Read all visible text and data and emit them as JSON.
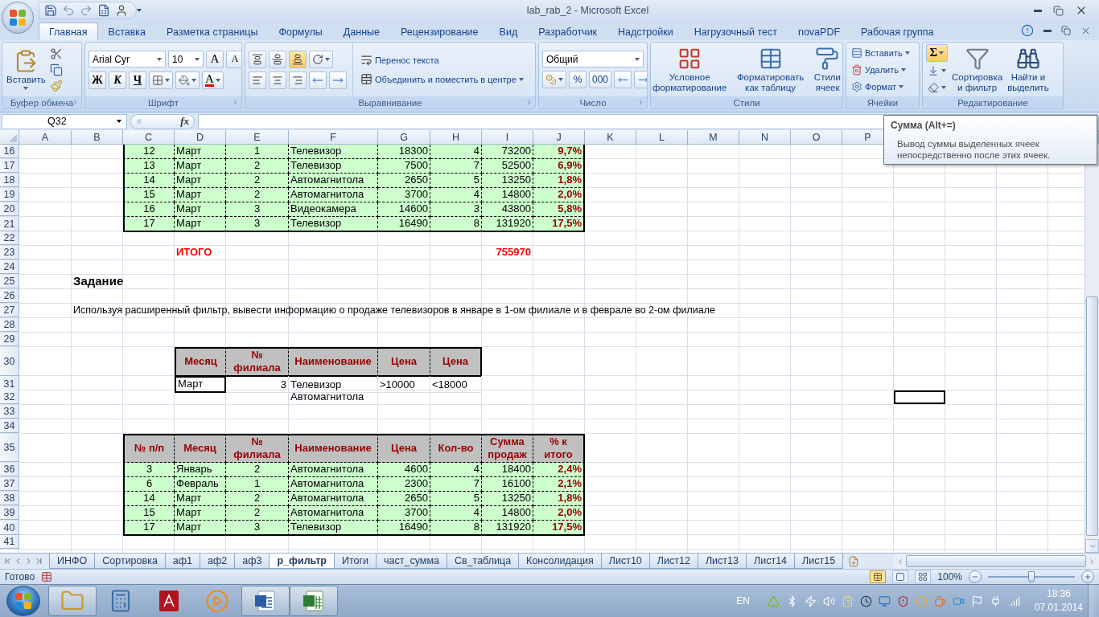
{
  "title_bar": {
    "title": "lab_rab_2 - Microsoft Excel"
  },
  "ribbon_tabs": [
    {
      "label": "Главная",
      "selected": true
    },
    {
      "label": "Вставка",
      "selected": false
    },
    {
      "label": "Разметка страницы",
      "selected": false
    },
    {
      "label": "Формулы",
      "selected": false
    },
    {
      "label": "Данные",
      "selected": false
    },
    {
      "label": "Рецензирование",
      "selected": false
    },
    {
      "label": "Вид",
      "selected": false
    },
    {
      "label": "Разработчик",
      "selected": false
    },
    {
      "label": "Надстройки",
      "selected": false
    },
    {
      "label": "Нагрузочный тест",
      "selected": false
    },
    {
      "label": "novaPDF",
      "selected": false
    },
    {
      "label": "Рабочая группа",
      "selected": false
    }
  ],
  "ribbon": {
    "clipboard": {
      "paste": "Вставить",
      "label": "Буфер обмена"
    },
    "font": {
      "name": "Arial Cyr",
      "size": "10",
      "grow": "A",
      "shrink": "A",
      "bold": "Ж",
      "italic": "К",
      "underline": "Ч",
      "color_letter": "A",
      "label": "Шрифт"
    },
    "alignment": {
      "vertical": [
        {
          "selected": false
        },
        {
          "selected": false
        },
        {
          "selected": true
        }
      ],
      "wrap": "Перенос текста",
      "merge": "Объединить и поместить в центре",
      "label": "Выравнивание"
    },
    "number": {
      "format": "Общий",
      "percent": "%",
      "thousands": "000",
      "label": "Число"
    },
    "styles": {
      "buttons": [
        "Условное\nформатирование",
        "Форматировать\nкак таблицу",
        "Стили\nячеек"
      ],
      "label": "Стили"
    },
    "cells": {
      "buttons": [
        "Вставить",
        "Удалить",
        "Формат"
      ],
      "label": "Ячейки"
    },
    "editing": {
      "sum": "Σ",
      "sum_hovered": true,
      "buttons": [
        "Сортировка\nи фильтр",
        "Найти и\nвыделить"
      ],
      "label": "Редактирование"
    }
  },
  "formula_bar": {
    "name_box": "Q32",
    "fx": "fx"
  },
  "sheet": {
    "columns": [
      "A",
      "B",
      "C",
      "D",
      "E",
      "F",
      "G",
      "H",
      "I",
      "J",
      "K",
      "L",
      "M",
      "N",
      "O",
      "P"
    ],
    "row_numbers": [
      "16",
      "17",
      "18",
      "19",
      "20",
      "21",
      "22",
      "23",
      "24",
      "25",
      "26",
      "27",
      "28",
      "29",
      "30",
      "31",
      "32",
      "33",
      "34",
      "35",
      "36",
      "37",
      "38",
      "39",
      "40",
      "41"
    ],
    "sales_rows": [
      [
        "12",
        "Март",
        "1",
        "Телевизор",
        "18300",
        "4",
        "73200",
        "9,7%"
      ],
      [
        "13",
        "Март",
        "2",
        "Телевизор",
        "7500",
        "7",
        "52500",
        "6,9%"
      ],
      [
        "14",
        "Март",
        "2",
        "Автомагнитола",
        "2650",
        "5",
        "13250",
        "1,8%"
      ],
      [
        "15",
        "Март",
        "2",
        "Автомагнитола",
        "3700",
        "4",
        "14800",
        "2,0%"
      ],
      [
        "16",
        "Март",
        "3",
        "Видеокамера",
        "14600",
        "3",
        "43800",
        "5,8%"
      ],
      [
        "17",
        "Март",
        "3",
        "Телевизор",
        "16490",
        "8",
        "131920",
        "17,5%"
      ]
    ],
    "total": {
      "label": "ИТОГО",
      "value": "755970"
    },
    "task_heading": "Задание",
    "task_text": "Используя расширенный фильтр, вывести информацию о продаже телевизоров в январе в 1-ом филиале и в феврале во 2-ом филиале",
    "criteria": {
      "headers": [
        "Месяц",
        "№\nфилиала",
        "Наименование",
        "Цена",
        "Цена"
      ],
      "rows": [
        {
          "month": "Март",
          "branch": "3",
          "name": "Телевизор",
          "price_min": ">10000",
          "price_max": "<18000"
        },
        {
          "name": "Автомагнитола"
        }
      ]
    },
    "result": {
      "headers": [
        "№ п/п",
        "Месяц",
        "№\nфилиала",
        "Наименование",
        "Цена",
        "Кол-во",
        "Сумма\nпродаж",
        "% к\nитого"
      ],
      "rows": [
        [
          "3",
          "Январь",
          "2",
          "Автомагнитола",
          "4600",
          "4",
          "18400",
          "2,4%"
        ],
        [
          "6",
          "Февраль",
          "1",
          "Автомагнитола",
          "2300",
          "7",
          "16100",
          "2,1%"
        ],
        [
          "14",
          "Март",
          "2",
          "Автомагнитола",
          "2650",
          "5",
          "13250",
          "1,8%"
        ],
        [
          "15",
          "Март",
          "2",
          "Автомагнитола",
          "3700",
          "4",
          "14800",
          "2,0%"
        ],
        [
          "17",
          "Март",
          "3",
          "Телевизор",
          "16490",
          "8",
          "131920",
          "17,5%"
        ]
      ]
    }
  },
  "tooltip": {
    "title": "Сумма (Alt+=)",
    "text": "Вывод суммы выделенных ячеек непосредственно после этих ячеек."
  },
  "sheet_tabs": [
    {
      "label": "ИНФО",
      "selected": false
    },
    {
      "label": "Сортировка",
      "selected": false
    },
    {
      "label": "аф1",
      "selected": false
    },
    {
      "label": "аф2",
      "selected": false
    },
    {
      "label": "аф3",
      "selected": false
    },
    {
      "label": "р_фильтр",
      "selected": true
    },
    {
      "label": "Итоги",
      "selected": false
    },
    {
      "label": "част_сумма",
      "selected": false
    },
    {
      "label": "Св_таблица",
      "selected": false
    },
    {
      "label": "Консолидация",
      "selected": false
    },
    {
      "label": "Лист10",
      "selected": false
    },
    {
      "label": "Лист12",
      "selected": false
    },
    {
      "label": "Лист13",
      "selected": false
    },
    {
      "label": "Лист14",
      "selected": false
    },
    {
      "label": "Лист15",
      "selected": false
    }
  ],
  "status_bar": {
    "text": "Готово",
    "views": [
      {
        "kind": "normal",
        "selected": true
      },
      {
        "kind": "layout",
        "selected": false
      },
      {
        "kind": "pagebreak",
        "selected": false
      }
    ],
    "zoom": "100%",
    "zoom_slider": {
      "level": 0.5
    }
  },
  "taskbar": {
    "apps": [
      {
        "kind": "explorer",
        "running": true
      },
      {
        "kind": "calculator",
        "running": false
      },
      {
        "kind": "acrobat",
        "running": false
      },
      {
        "kind": "media",
        "running": false
      },
      {
        "kind": "word",
        "running": true
      },
      {
        "kind": "excel",
        "running": true
      }
    ],
    "language": "EN",
    "time": "18:36",
    "date": "07.01.2014"
  }
}
